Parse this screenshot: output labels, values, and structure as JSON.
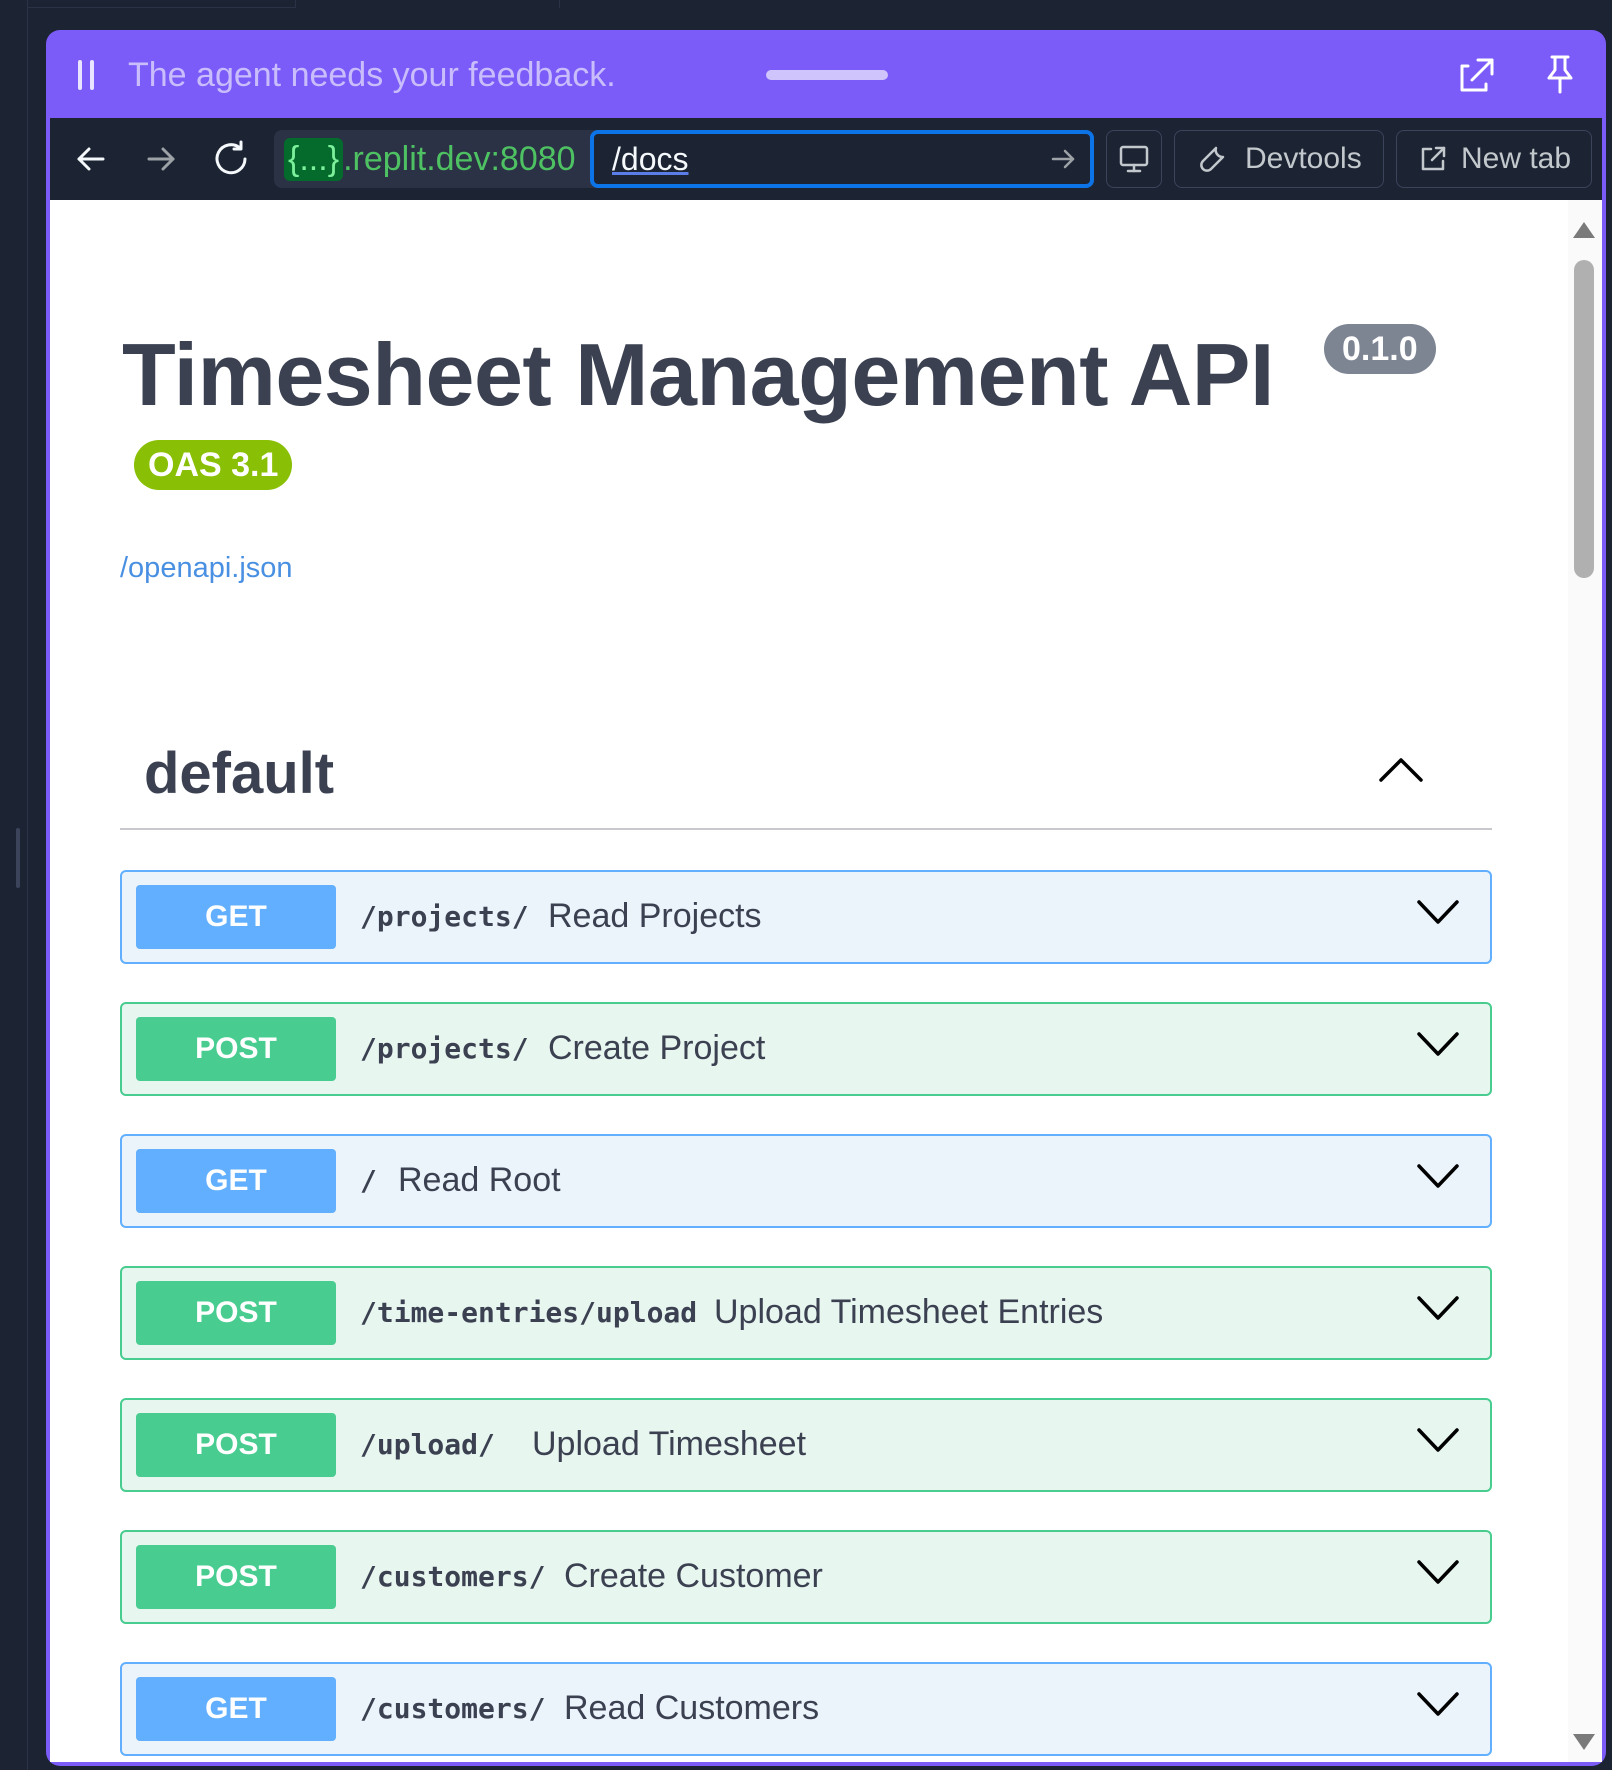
{
  "feedback_bar": {
    "message": "The agent needs your feedback."
  },
  "browser": {
    "url_origin_prefix": "{...}",
    "url_origin_suffix": ".replit.dev:8080",
    "url_path": "/docs",
    "devtools_label": "Devtools",
    "new_tab_label": "New tab"
  },
  "page": {
    "title": "Timesheet Management API",
    "version": "0.1.0",
    "oas_version": "OAS 3.1",
    "spec_link": "/openapi.json",
    "tag_name": "default",
    "operations": [
      {
        "method": "GET",
        "path": "/projects/",
        "summary": "Read Projects"
      },
      {
        "method": "POST",
        "path": "/projects/",
        "summary": "Create Project"
      },
      {
        "method": "GET",
        "path": "/",
        "summary": "Read Root"
      },
      {
        "method": "POST",
        "path": "/time-entries/upload",
        "summary": "Upload Timesheet Entries"
      },
      {
        "method": "POST",
        "path": "/upload/",
        "summary": "Upload Timesheet"
      },
      {
        "method": "POST",
        "path": "/customers/",
        "summary": "Create Customer"
      },
      {
        "method": "GET",
        "path": "/customers/",
        "summary": "Read Customers"
      }
    ]
  },
  "colors": {
    "get": "#61affe",
    "post": "#49cc90",
    "panel_accent": "#7b5cf9"
  }
}
